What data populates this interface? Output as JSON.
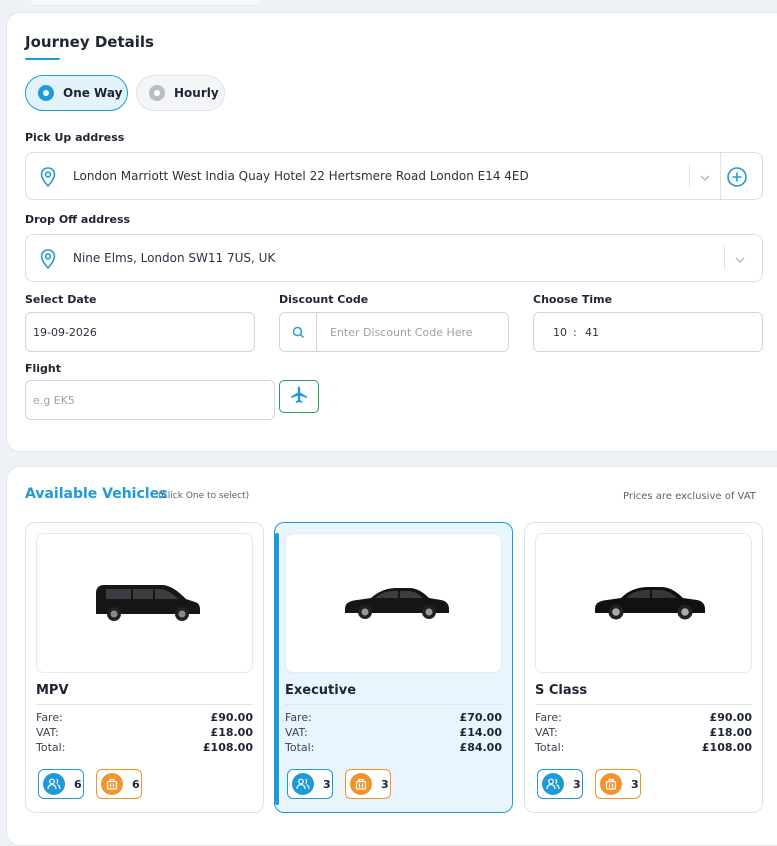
{
  "journey": {
    "title": "Journey Details",
    "trip_type": {
      "options": [
        "One Way",
        "Hourly"
      ],
      "selected": "One Way"
    },
    "pickup": {
      "label": "Pick Up address",
      "value": "London Marriott West India Quay Hotel 22 Hertsmere Road London E14 4ED"
    },
    "dropoff": {
      "label": "Drop Off address",
      "value": "Nine Elms, London SW11 7US, UK"
    },
    "date": {
      "label": "Select Date",
      "value": "19-09-2026"
    },
    "discount": {
      "label": "Discount Code",
      "placeholder": "Enter Discount Code Here"
    },
    "time": {
      "label": "Choose Time",
      "hour": "10",
      "sep": ":",
      "minute": "41"
    },
    "flight": {
      "label": "Flight",
      "placeholder": "e.g EK5"
    }
  },
  "vehicles": {
    "title": "Available Vehicles",
    "subtitle": "(Click One to select)",
    "note": "Prices are exclusive of VAT",
    "selected": "Executive",
    "items": [
      {
        "name": "MPV",
        "fare_label": "Fare:",
        "fare": "£90.00",
        "vat_label": "VAT:",
        "vat": "£18.00",
        "total_label": "Total:",
        "total": "£108.00",
        "passengers": "6",
        "luggage": "6",
        "image": "black-mpv-van"
      },
      {
        "name": "Executive",
        "fare_label": "Fare:",
        "fare": "£70.00",
        "vat_label": "VAT:",
        "vat": "£14.00",
        "total_label": "Total:",
        "total": "£84.00",
        "passengers": "3",
        "luggage": "3",
        "image": "black-executive-sedan"
      },
      {
        "name": "S Class",
        "fare_label": "Fare:",
        "fare": "£90.00",
        "vat_label": "VAT:",
        "vat": "£18.00",
        "total_label": "Total:",
        "total": "£108.00",
        "passengers": "3",
        "luggage": "3",
        "image": "black-s-class-sedan"
      }
    ]
  },
  "colors": {
    "accent": "#1e9bd7",
    "selected_bg": "#e8f5fc",
    "luggage": "#f0952d",
    "flight_border": "#2e9a58"
  }
}
